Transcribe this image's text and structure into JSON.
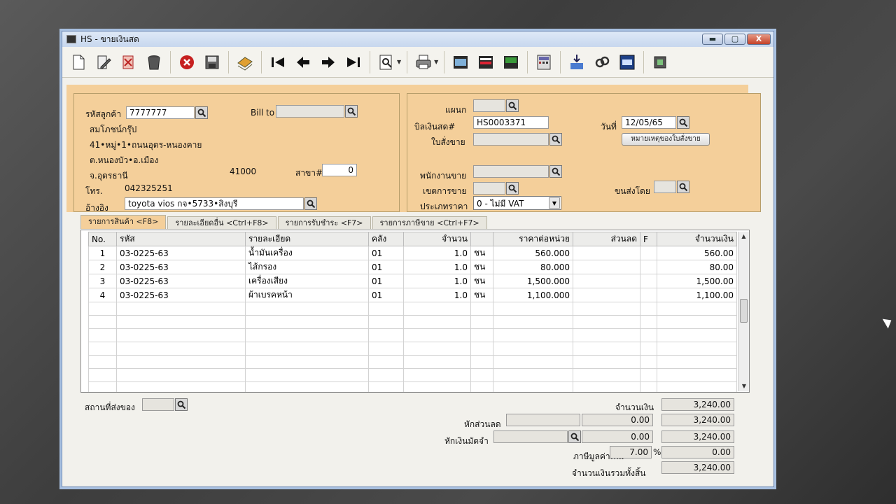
{
  "window": {
    "title": "HS - ขายเงินสด",
    "min": "▬",
    "max": "▢",
    "close": "X"
  },
  "toolbar": {
    "buttons": [
      "new-doc-icon",
      "edit-doc-icon",
      "cancel-doc-icon",
      "delete-icon",
      "close-circle-icon",
      "save-icon",
      "batch-icon",
      "first-record-icon",
      "previous-record-icon",
      "next-record-icon",
      "last-record-icon",
      "search-doc-icon",
      "print-icon",
      "report-1-icon",
      "report-2-icon",
      "report-3-icon",
      "calculator-icon",
      "download-dk-icon",
      "link-icon",
      "ok-icon",
      "exit-icon"
    ]
  },
  "customer": {
    "code_label": "รหัสลูกค้า",
    "code": "7777777",
    "bill_to_label": "Bill to",
    "bill_to": "",
    "name": "สมโภชน์กรุ๊ป",
    "address1": "41•หมู่•1•ถนนอุดร-หนองคาย",
    "address2": "ต.หนองบัว•อ.เมือง",
    "province": "จ.อุดรธานี",
    "postcode": "41000",
    "branch_label": "สาขา#",
    "branch": "0",
    "phone_label": "โทร.",
    "phone": "042325251",
    "ref_label": "อ้างอิง",
    "ref": "toyota vios กจ•5733•สิงบุรี"
  },
  "doc": {
    "dept_label": "แผนก",
    "dept": "",
    "bill_label": "บิลเงินสด#",
    "bill_no": "HS0003371",
    "order_label": "ใบสั่งขาย",
    "order": "",
    "date_label": "วันที่",
    "date": "12/05/65",
    "note_btn": "หมายเหตุของใบสั่งขาย",
    "sales_label": "พนักงานขาย",
    "sales": "",
    "area_label": "เขตการขาย",
    "area": "",
    "ship_label": "ขนส่งโดย",
    "ship": "",
    "price_type_label": "ประเภทราคา",
    "price_type": "0 - ไม่มี VAT"
  },
  "tabs": [
    "รายการสินค้า <F8>",
    "รายละเอียดอื่น <Ctrl+F8>",
    "รายการรับชำระ <F7>",
    "รายการภาษีขาย <Ctrl+F7>"
  ],
  "grid": {
    "headers": [
      "No.",
      "รหัส",
      "รายละเอียด",
      "คลัง",
      "จำนวน",
      "",
      "ราคาต่อหน่วย",
      "ส่วนลด",
      "F",
      "จำนวนเงิน"
    ],
    "rows": [
      {
        "no": "1",
        "code": "03-0225-63",
        "desc": "น้ำมันเครื่อง",
        "wh": "01",
        "qty": "1.0",
        "unit": "ชน",
        "price": "560.000",
        "disc": "",
        "f": "",
        "amount": "560.00"
      },
      {
        "no": "2",
        "code": "03-0225-63",
        "desc": "ไส้กรอง",
        "wh": "01",
        "qty": "1.0",
        "unit": "ชน",
        "price": "80.000",
        "disc": "",
        "f": "",
        "amount": "80.00"
      },
      {
        "no": "3",
        "code": "03-0225-63",
        "desc": "เครื่องเสียง",
        "wh": "01",
        "qty": "1.0",
        "unit": "ชน",
        "price": "1,500.000",
        "disc": "",
        "f": "",
        "amount": "1,500.00"
      },
      {
        "no": "4",
        "code": "03-0225-63",
        "desc": "ผ้าเบรคหน้า",
        "wh": "01",
        "qty": "1.0",
        "unit": "ชน",
        "price": "1,100.000",
        "disc": "",
        "f": "",
        "amount": "1,100.00"
      }
    ],
    "empty_rows": 7
  },
  "footer": {
    "ship_place_label": "สถานที่ส่งของ",
    "ship_place": "",
    "total_label": "จำนวนเงิน",
    "total": "3,240.00",
    "discount_label": "หักส่วนลด",
    "discount_text": "",
    "discount": "0.00",
    "after_discount": "3,240.00",
    "deposit_label": "หักเงินมัดจำ",
    "deposit_text": "",
    "deposit": "0.00",
    "after_deposit": "3,240.00",
    "vat_label": "ภาษีมูลค่าเพิ่ม",
    "vat_rate": "7.00",
    "vat_pct": "%",
    "vat": "0.00",
    "grand_label": "จำนวนเงินรวมทั้งสิ้น",
    "grand": "3,240.00"
  }
}
